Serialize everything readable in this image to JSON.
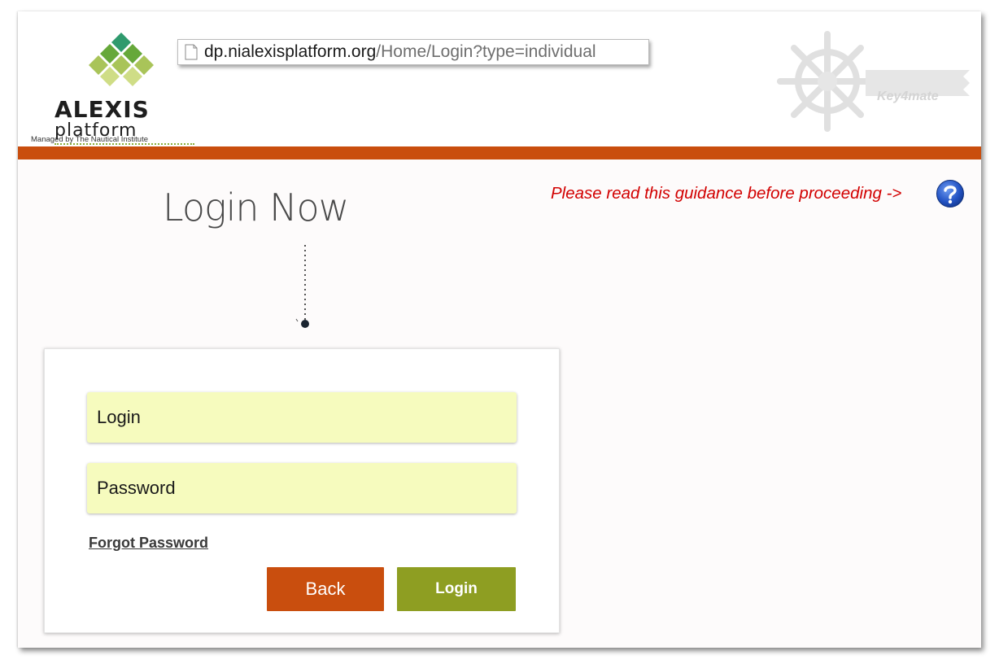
{
  "browser": {
    "url_host": "dp.nialexisplatform.org",
    "url_path": "/Home/Login?type=individual"
  },
  "header": {
    "logo_brand_line1": "ALEXIS",
    "logo_brand_line2": "platform",
    "logo_tagline": "Managed by The Nautical Institute",
    "partner_logo_text": "Key4mate"
  },
  "main": {
    "title": "Login Now",
    "guidance_text": "Please read this guidance before proceeding ->"
  },
  "form": {
    "login_placeholder": "Login",
    "password_placeholder": "Password",
    "forgot_password_label": "Forgot Password",
    "back_label": "Back",
    "login_label": "Login"
  },
  "colors": {
    "header_bar": "#c94e0e",
    "back_button": "#c94e0e",
    "login_button": "#8e9e22",
    "input_background": "#f6fbbe",
    "guidance_text": "#d20000",
    "help_icon": "#2458c6"
  }
}
